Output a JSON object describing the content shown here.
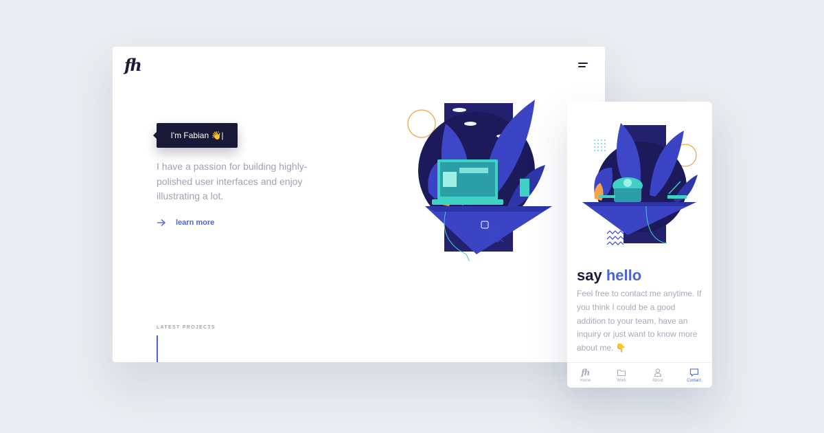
{
  "desktop": {
    "logo": "fh",
    "greeting": "I'm Fabian 👋|",
    "intro": "I have a passion for building highly-polished user interfaces and enjoy illustrating a lot.",
    "learn_more": "learn more",
    "latest_projects": "LATEST PROJECTS",
    "menu_icon": "hamburger-icon"
  },
  "mobile": {
    "title_plain": "say ",
    "title_highlight": "hello",
    "body": "Feel free to contact me anytime. If you think I could be a good addition to your team, have an inquiry or just want to know more about me. 👇",
    "tabs": [
      {
        "label": "Home",
        "icon": "fh-logo-icon"
      },
      {
        "label": "Work",
        "icon": "folder-icon"
      },
      {
        "label": "About",
        "icon": "user-icon"
      },
      {
        "label": "Contact",
        "icon": "chat-icon"
      }
    ],
    "active_tab": "Contact"
  },
  "colors": {
    "accent": "#4e63d8",
    "dark": "#1b1c3a",
    "muted": "#9ea2b4",
    "teal": "#3fd1c4",
    "illustration_dark": "#2a2878",
    "illustration_blue": "#3f47c9",
    "orange": "#f5a24b"
  }
}
